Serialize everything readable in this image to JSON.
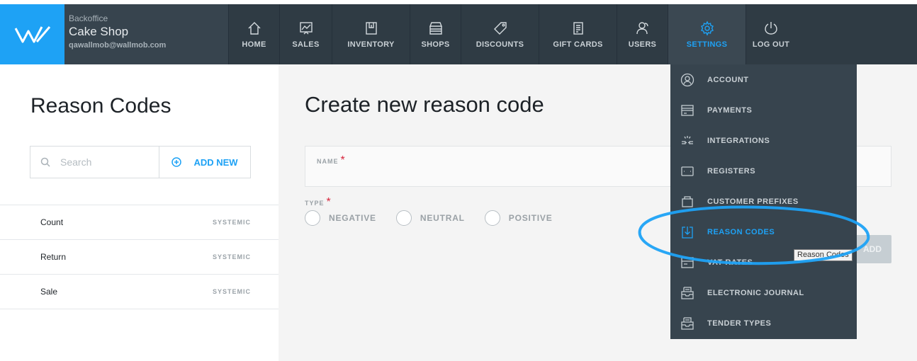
{
  "brand": {
    "app_name": "Backoffice",
    "shop_name": "Cake Shop",
    "email": "qawallmob@wallmob.com"
  },
  "nav": {
    "home": "HOME",
    "sales": "SALES",
    "inventory": "INVENTORY",
    "shops": "SHOPS",
    "discounts": "DISCOUNTS",
    "gift_cards": "GIFT CARDS",
    "users": "USERS",
    "settings": "SETTINGS",
    "logout": "LOG OUT"
  },
  "left": {
    "title": "Reason Codes",
    "search_placeholder": "Search",
    "add_new": "ADD NEW",
    "rows": [
      {
        "name": "Count",
        "tag": "SYSTEMIC"
      },
      {
        "name": "Return",
        "tag": "SYSTEMIC"
      },
      {
        "name": "Sale",
        "tag": "SYSTEMIC"
      }
    ]
  },
  "form": {
    "title": "Create new reason code",
    "name_label": "NAME",
    "type_label": "TYPE",
    "required_mark": "*",
    "types": [
      "NEGATIVE",
      "NEUTRAL",
      "POSITIVE"
    ],
    "add_button": "ADD"
  },
  "settings_menu": {
    "items": [
      "ACCOUNT",
      "PAYMENTS",
      "INTEGRATIONS",
      "REGISTERS",
      "CUSTOMER PREFIXES",
      "REASON CODES",
      "VAT RATES",
      "ELECTRONIC JOURNAL",
      "TENDER TYPES"
    ],
    "active": "REASON CODES",
    "tooltip": "Reason Codes"
  },
  "colors": {
    "accent": "#1ea2f5",
    "nav_bg": "#2f3b44",
    "menu_bg": "#37444e",
    "annotation": "#1ea2f5"
  }
}
